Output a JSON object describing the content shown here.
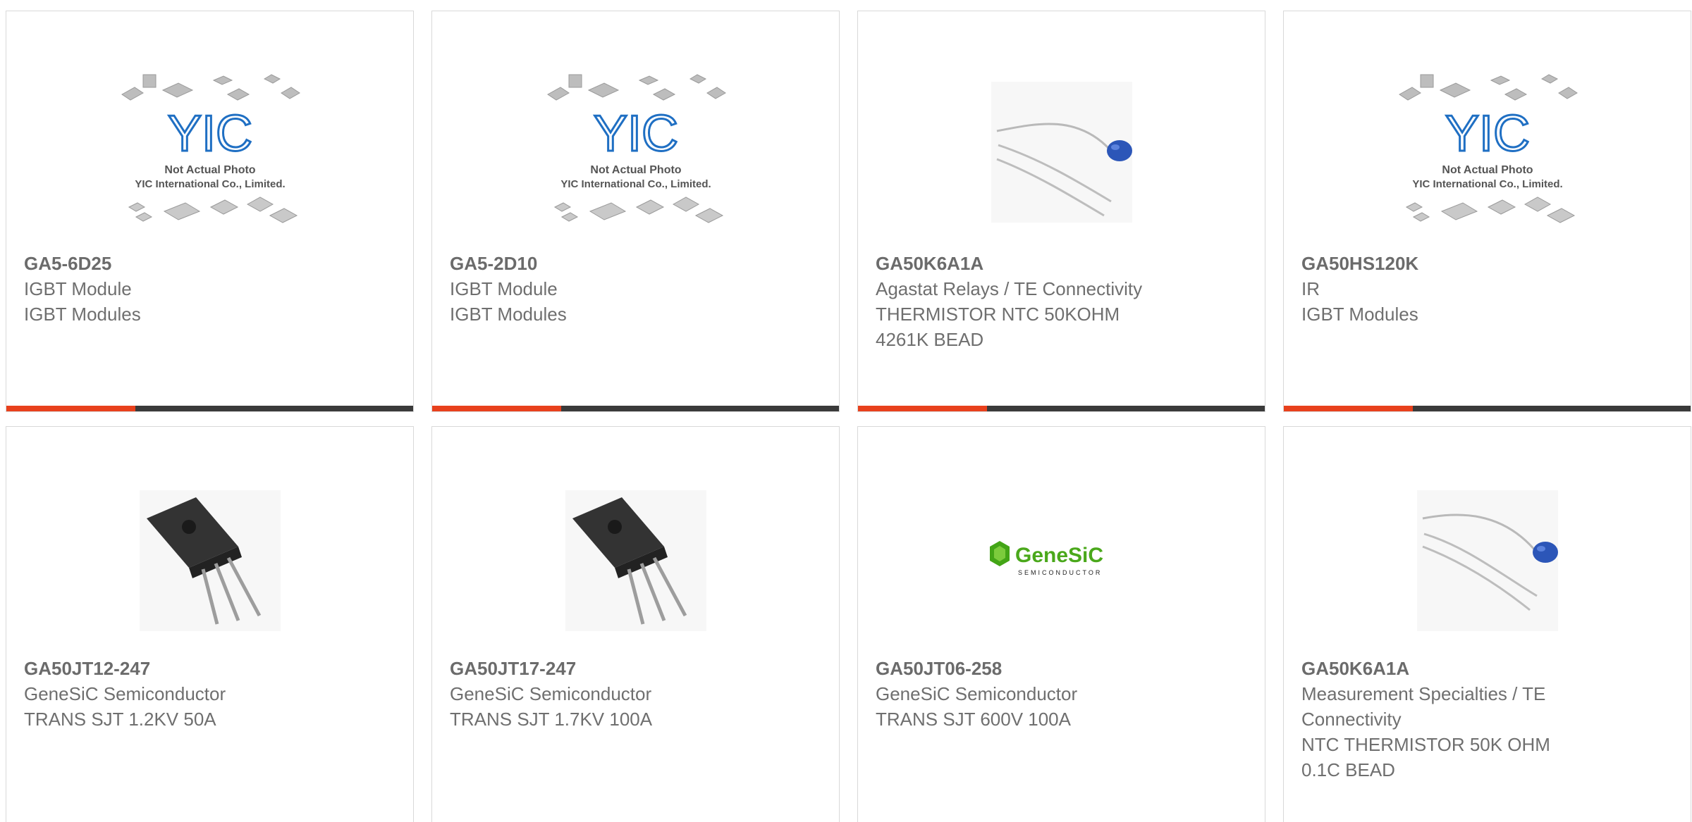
{
  "colors": {
    "accent": "#e8401c",
    "bar": "#3a3a3a",
    "text": "#6f6f6f",
    "border": "#d9d9d9"
  },
  "placeholder": {
    "logo": "YIC",
    "line1": "Not Actual Photo",
    "line2": "YIC International Co., Limited."
  },
  "genesic_logo": {
    "brand": "GeneSiC",
    "sub": "SEMICONDUCTOR"
  },
  "products": [
    {
      "pn": "GA5-6D25",
      "l1": "IGBT Module",
      "l2": "IGBT Modules",
      "l3": "",
      "image": "yic-placeholder"
    },
    {
      "pn": "GA5-2D10",
      "l1": "IGBT Module",
      "l2": "IGBT Modules",
      "l3": "",
      "image": "yic-placeholder"
    },
    {
      "pn": "GA50K6A1A",
      "l1": "Agastat Relays / TE Connectivity",
      "l2": "THERMISTOR NTC 50KOHM",
      "l3": "4261K BEAD",
      "image": "thermistor-bead"
    },
    {
      "pn": "GA50HS120K",
      "l1": "IR",
      "l2": "IGBT Modules",
      "l3": "",
      "image": "yic-placeholder"
    },
    {
      "pn": "GA50JT12-247",
      "l1": "GeneSiC Semiconductor",
      "l2": "TRANS SJT 1.2KV 50A",
      "l3": "",
      "image": "to247-transistor"
    },
    {
      "pn": "GA50JT17-247",
      "l1": "GeneSiC Semiconductor",
      "l2": "TRANS SJT 1.7KV 100A",
      "l3": "",
      "image": "to247-transistor"
    },
    {
      "pn": "GA50JT06-258",
      "l1": "GeneSiC Semiconductor",
      "l2": "TRANS SJT 600V 100A",
      "l3": "",
      "image": "genesic-logo"
    },
    {
      "pn": "GA50K6A1A",
      "l1": "Measurement Specialties / TE",
      "l2": "Connectivity",
      "l3": "NTC THERMISTOR 50K OHM",
      "l4": "0.1C BEAD",
      "image": "thermistor-bead"
    }
  ]
}
